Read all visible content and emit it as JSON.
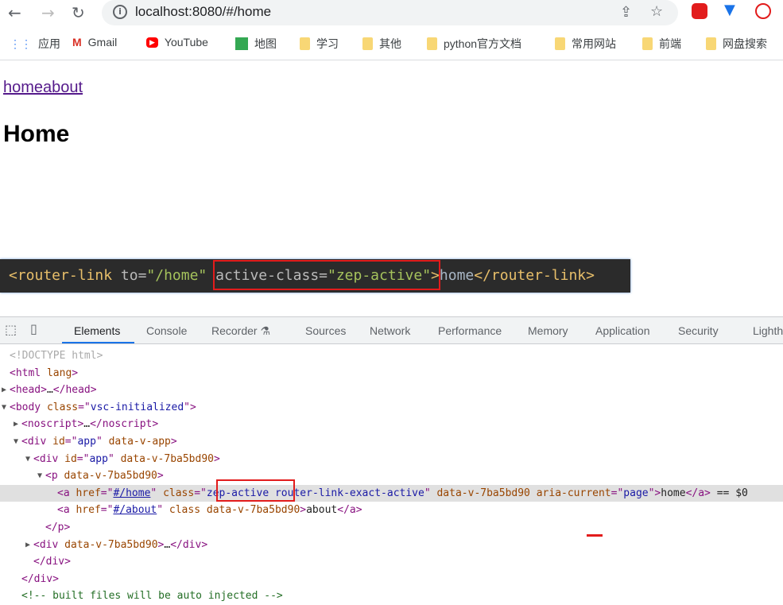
{
  "browser": {
    "url": "localhost:8080/#/home",
    "extensions": [
      "adblock-icon",
      "vpn-icon",
      "media-icon"
    ]
  },
  "bookmarks": [
    {
      "label": "应用",
      "icon": "apps-icon"
    },
    {
      "label": "Gmail",
      "icon": "gmail-icon"
    },
    {
      "label": "YouTube",
      "icon": "youtube-icon"
    },
    {
      "label": "地图",
      "icon": "maps-icon"
    },
    {
      "label": "学习",
      "icon": "folder-icon"
    },
    {
      "label": "其他",
      "icon": "folder-icon"
    },
    {
      "label": "python官方文档",
      "icon": "folder-icon"
    },
    {
      "label": "常用网站",
      "icon": "folder-icon"
    },
    {
      "label": "前端",
      "icon": "folder-icon"
    },
    {
      "label": "网盘搜索",
      "icon": "folder-icon"
    }
  ],
  "page": {
    "links": "homeabout",
    "heading": "Home"
  },
  "snippet": {
    "open": "<router-link ",
    "to_attr": "to=",
    "to_val": "\"/home\"",
    "sp": " ",
    "ac_attr": "active-class=",
    "ac_val": "\"zep-active\"",
    "close": ">",
    "text": "home",
    "end": "</router-link>"
  },
  "devtools": {
    "tabs": [
      "Elements",
      "Console",
      "Recorder",
      "Sources",
      "Network",
      "Performance",
      "Memory",
      "Application",
      "Security",
      "Lighth"
    ],
    "active_tab": "Elements"
  },
  "dom_lines": [
    {
      "depth": 0,
      "tri": "",
      "segs": [
        [
          "dim",
          "<!DOCTYPE html>"
        ]
      ]
    },
    {
      "depth": 0,
      "tri": "",
      "segs": [
        [
          "tg",
          "<html "
        ],
        [
          "at",
          "lang"
        ],
        [
          "tg",
          ">"
        ]
      ]
    },
    {
      "depth": 0,
      "tri": "▶",
      "segs": [
        [
          "tg",
          "<head>"
        ],
        [
          "tx",
          "…"
        ],
        [
          "tg",
          "</head>"
        ]
      ]
    },
    {
      "depth": 0,
      "tri": "▼",
      "segs": [
        [
          "tg",
          "<body "
        ],
        [
          "at",
          "class"
        ],
        [
          "tg",
          "=\""
        ],
        [
          "va",
          "vsc-initialized"
        ],
        [
          "tg",
          "\">"
        ]
      ]
    },
    {
      "depth": 1,
      "tri": "▶",
      "segs": [
        [
          "tg",
          "<noscript>"
        ],
        [
          "tx",
          "…"
        ],
        [
          "tg",
          "</noscript>"
        ]
      ]
    },
    {
      "depth": 1,
      "tri": "▼",
      "segs": [
        [
          "tg",
          "<div "
        ],
        [
          "at",
          "id"
        ],
        [
          "tg",
          "=\""
        ],
        [
          "va",
          "app"
        ],
        [
          "tg",
          "\" "
        ],
        [
          "at",
          "data-v-app"
        ],
        [
          "tg",
          ">"
        ]
      ]
    },
    {
      "depth": 2,
      "tri": "▼",
      "segs": [
        [
          "tg",
          "<div "
        ],
        [
          "at",
          "id"
        ],
        [
          "tg",
          "=\""
        ],
        [
          "va",
          "app"
        ],
        [
          "tg",
          "\" "
        ],
        [
          "at",
          "data-v-7ba5bd90"
        ],
        [
          "tg",
          ">"
        ]
      ]
    },
    {
      "depth": 3,
      "tri": "▼",
      "segs": [
        [
          "tg",
          "<p "
        ],
        [
          "at",
          "data-v-7ba5bd90"
        ],
        [
          "tg",
          ">"
        ]
      ]
    },
    {
      "depth": 4,
      "tri": "",
      "sel": true,
      "segs": [
        [
          "tg",
          "<a "
        ],
        [
          "at",
          "href"
        ],
        [
          "tg",
          "=\""
        ],
        [
          "lk",
          "#/home"
        ],
        [
          "tg",
          "\" "
        ],
        [
          "at",
          "class"
        ],
        [
          "tg",
          "=\""
        ],
        [
          "va",
          "zep-active"
        ],
        [
          "va",
          " router-link-exact-active"
        ],
        [
          "tg",
          "\" "
        ],
        [
          "at",
          "data-v-7ba5bd90 aria-current"
        ],
        [
          "tg",
          "=\""
        ],
        [
          "va",
          "page"
        ],
        [
          "tg",
          "\">"
        ],
        [
          "tx",
          "home"
        ],
        [
          "tg",
          "</a>"
        ],
        [
          "tx",
          " == $0"
        ]
      ]
    },
    {
      "depth": 4,
      "tri": "",
      "segs": [
        [
          "tg",
          "<a "
        ],
        [
          "at",
          "href"
        ],
        [
          "tg",
          "=\""
        ],
        [
          "lk",
          "#/about"
        ],
        [
          "tg",
          "\" "
        ],
        [
          "at",
          "class data-v-7ba5bd90"
        ],
        [
          "tg",
          ">"
        ],
        [
          "tx",
          "about"
        ],
        [
          "tg",
          "</a>"
        ]
      ]
    },
    {
      "depth": 3,
      "tri": "",
      "segs": [
        [
          "tg",
          "</p>"
        ]
      ]
    },
    {
      "depth": 2,
      "tri": "▶",
      "segs": [
        [
          "tg",
          "<div "
        ],
        [
          "at",
          "data-v-7ba5bd90"
        ],
        [
          "tg",
          ">"
        ],
        [
          "tx",
          "…"
        ],
        [
          "tg",
          "</div>"
        ]
      ]
    },
    {
      "depth": 2,
      "tri": "",
      "segs": [
        [
          "tg",
          "</div>"
        ]
      ]
    },
    {
      "depth": 1,
      "tri": "",
      "segs": [
        [
          "tg",
          "</div>"
        ]
      ]
    },
    {
      "depth": 1,
      "tri": "",
      "segs": [
        [
          "cm",
          "<!-- built files will be auto injected -->"
        ]
      ]
    }
  ],
  "colors": {
    "highlight_box": "#e21c1c",
    "active_tab": "#1a73e8"
  }
}
